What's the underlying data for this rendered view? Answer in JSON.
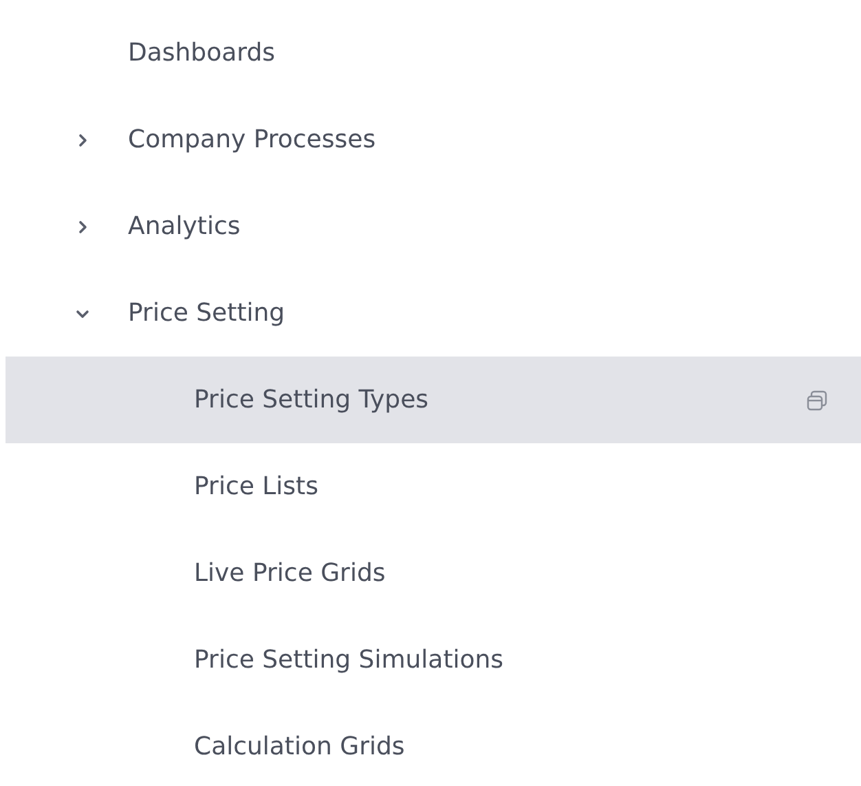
{
  "nav": [
    {
      "kind": "link",
      "label": "Dashboards"
    },
    {
      "kind": "folder",
      "label": "Company Processes",
      "expanded": false
    },
    {
      "kind": "folder",
      "label": "Analytics",
      "expanded": false
    },
    {
      "kind": "folder",
      "label": "Price Setting",
      "expanded": true,
      "children": [
        {
          "label": "Price Setting Types",
          "selected": true
        },
        {
          "label": "Price Lists",
          "selected": false
        },
        {
          "label": "Live Price Grids",
          "selected": false
        },
        {
          "label": "Price Setting Simulations",
          "selected": false
        },
        {
          "label": "Calculation Grids",
          "selected": false
        }
      ]
    }
  ]
}
